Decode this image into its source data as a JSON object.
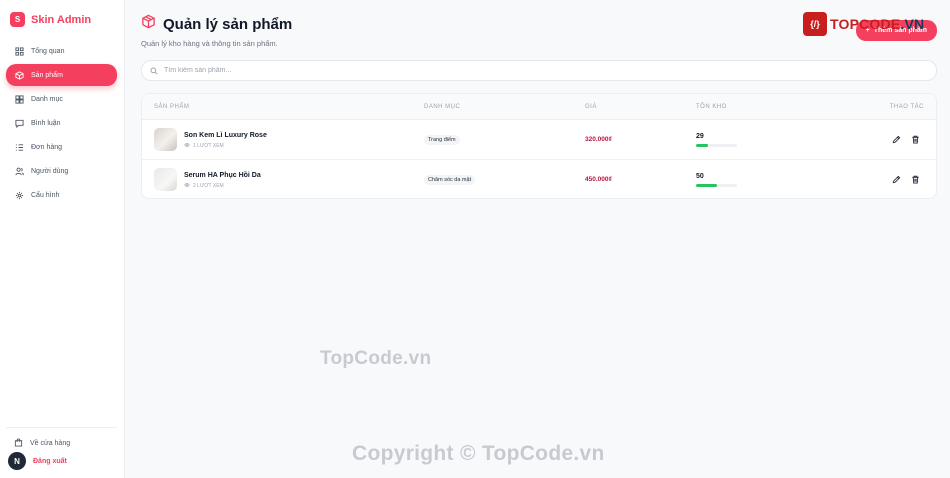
{
  "brand": {
    "logo_letter": "S",
    "name": "Skin Admin"
  },
  "sidebar": {
    "items": [
      {
        "label": "Tổng quan",
        "icon": "grid-icon",
        "active": false
      },
      {
        "label": "Sản phẩm",
        "icon": "box-icon",
        "active": true
      },
      {
        "label": "Danh mục",
        "icon": "category-icon",
        "active": false
      },
      {
        "label": "Bình luận",
        "icon": "comment-icon",
        "active": false
      },
      {
        "label": "Đơn hàng",
        "icon": "list-icon",
        "active": false
      },
      {
        "label": "Người dùng",
        "icon": "users-icon",
        "active": false
      },
      {
        "label": "Cấu hình",
        "icon": "gear-icon",
        "active": false
      }
    ],
    "store_label": "Về cửa hàng",
    "user_initial": "N",
    "logout_label": "Đăng xuất"
  },
  "header": {
    "title": "Quản lý sản phẩm",
    "subtitle": "Quản lý kho hàng và thông tin sản phẩm.",
    "add_button_label": "Thêm sản phẩm"
  },
  "search": {
    "placeholder": "Tìm kiếm sản phẩm..."
  },
  "table": {
    "columns": [
      "SẢN PHẨM",
      "DANH MỤC",
      "GIÁ",
      "TỒN KHO",
      "THAO TÁC"
    ],
    "rows": [
      {
        "name": "Son Kem Lì Luxury Rose",
        "views": "1 LƯỢT XEM",
        "category": "Trang điểm",
        "price": "320.000₫",
        "stock": "29",
        "stock_fraction": 0.29
      },
      {
        "name": "Serum HA Phục Hồi Da",
        "views": "2 LƯỢT XEM",
        "category": "Chăm sóc da mặt",
        "price": "450.000₫",
        "stock": "50",
        "stock_fraction": 0.5
      }
    ]
  },
  "watermarks": {
    "logo_badge": "{/}",
    "logo_text_main": "TOPCODE",
    "logo_text_suffix": ".VN",
    "center": "TopCode.vn",
    "footer": "Copyright © TopCode.vn"
  },
  "colors": {
    "accent": "#f43f5e",
    "price": "#be123c",
    "stock_bar": "#22c55e"
  }
}
